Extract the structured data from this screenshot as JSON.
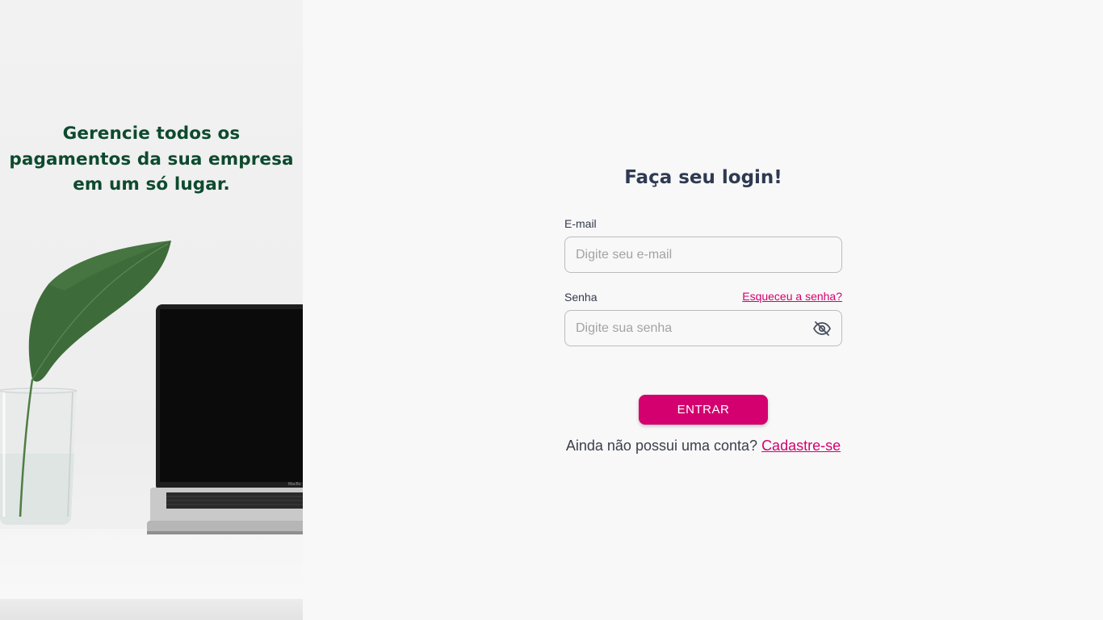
{
  "hero": {
    "title": "Gerencie todos os pagamentos da sua empresa em um só lugar.",
    "laptop_brand": "MacBo"
  },
  "login": {
    "title": "Faça seu login!",
    "email": {
      "label": "E-mail",
      "placeholder": "Digite seu e-mail",
      "value": ""
    },
    "password": {
      "label": "Senha",
      "placeholder": "Digite sua senha",
      "value": "",
      "forgot_label": "Esqueceu a senha?",
      "toggle_icon": "eye-off-icon"
    },
    "submit_label": "ENTRAR",
    "signup_prompt": "Ainda não possui uma conta?",
    "signup_link": "Cadastre-se"
  },
  "colors": {
    "accent": "#d4006f",
    "hero_text": "#0d4a2e",
    "title_text": "#2e3a52",
    "background": "#f8f8f8"
  }
}
